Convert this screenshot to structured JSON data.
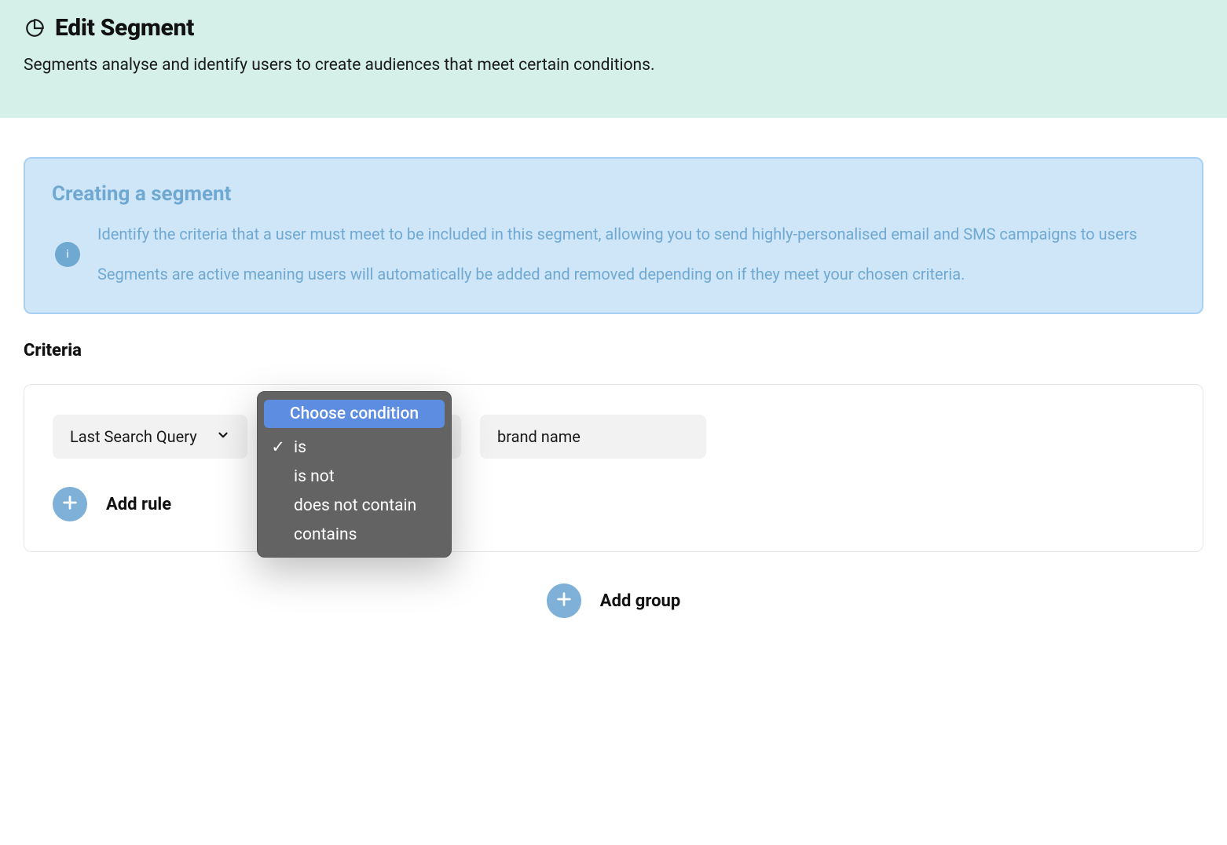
{
  "header": {
    "title": "Edit Segment",
    "subtitle": "Segments analyse and identify users to create audiences that meet certain conditions."
  },
  "info": {
    "title": "Creating a segment",
    "icon_letter": "i",
    "p1": "Identify the criteria that a user must meet to be included in this segment, allowing you to send highly-personalised email and SMS campaigns to users",
    "p2": "Segments are active meaning users will automatically be added and removed depending on if they meet your chosen criteria."
  },
  "criteria": {
    "heading": "Criteria",
    "property_select_value": "Last Search Query",
    "condition_select_value": "is",
    "value_input": "brand name",
    "add_rule_label": "Add rule"
  },
  "dropdown": {
    "header": "Choose condition",
    "selected": "is",
    "options": [
      "is",
      "is not",
      "does not contain",
      "contains"
    ]
  },
  "add_group_label": "Add group"
}
